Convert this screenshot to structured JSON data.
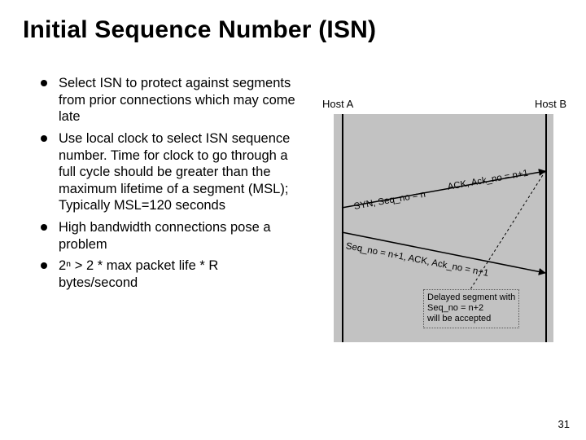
{
  "title": "Initial Sequence Number (ISN)",
  "bullets": [
    "Select ISN to protect against segments from prior connections which may come late",
    "Use local clock to select ISN sequence number.  Time for clock to go through a full cycle should be greater than the maximum lifetime of a segment (MSL);  Typically MSL=120 seconds",
    "High bandwidth connections pose a problem",
    "2ⁿ > 2 * max packet life * R bytes/second"
  ],
  "diagram": {
    "hostA": "Host A",
    "hostB": "Host B",
    "msg1": "SYN, Seq_no = n",
    "msg2": "ACK, Ack_no = n+1",
    "msg3": "Seq_no = n+1, ACK, Ack_no = n+1",
    "note": "Delayed segment with\nSeq_no = n+2\nwill be accepted"
  },
  "page_number": "31"
}
